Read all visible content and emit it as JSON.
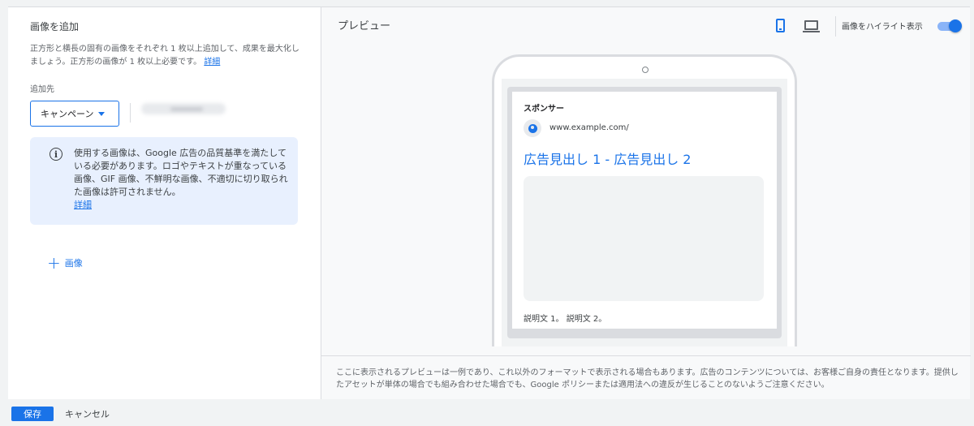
{
  "left_panel": {
    "title": "画像を追加",
    "description": "正方形と横長の固有の画像をそれぞれ 1 枚以上追加して、成果を最大化しましょう。正方形の画像が 1 枚以上必要です。",
    "description_link": "詳細",
    "destination_label": "追加先",
    "campaign_select": "キャンペーン",
    "info": {
      "icon": "info-icon",
      "text": "使用する画像は、Google 広告の品質基準を満たしている必要があります。ロゴやテキストが重なっている画像、GIF 画像、不鮮明な画像、不適切に切り取られた画像は許可されません。",
      "link": "詳細"
    },
    "add_image_label": "画像"
  },
  "preview": {
    "title": "プレビュー",
    "highlight_label": "画像をハイライト表示",
    "highlight_on": true,
    "ad": {
      "sponsor": "スポンサー",
      "url": "www.example.com/",
      "headline": "広告見出し 1 - 広告見出し 2",
      "description": "説明文 1。 説明文 2。"
    },
    "footer_note": "ここに表示されるプレビューは一例であり、これ以外のフォーマットで表示される場合もあります。広告のコンテンツについては、お客様ご自身の責任となります。提供したアセットが単体の場合でも組み合わせた場合でも、Google ポリシーまたは適用法への違反が生じることのないようご注意ください。"
  },
  "actions": {
    "save": "保存",
    "cancel": "キャンセル"
  },
  "colors": {
    "accent": "#1a73e8",
    "info_bg": "#e8f0fe"
  }
}
